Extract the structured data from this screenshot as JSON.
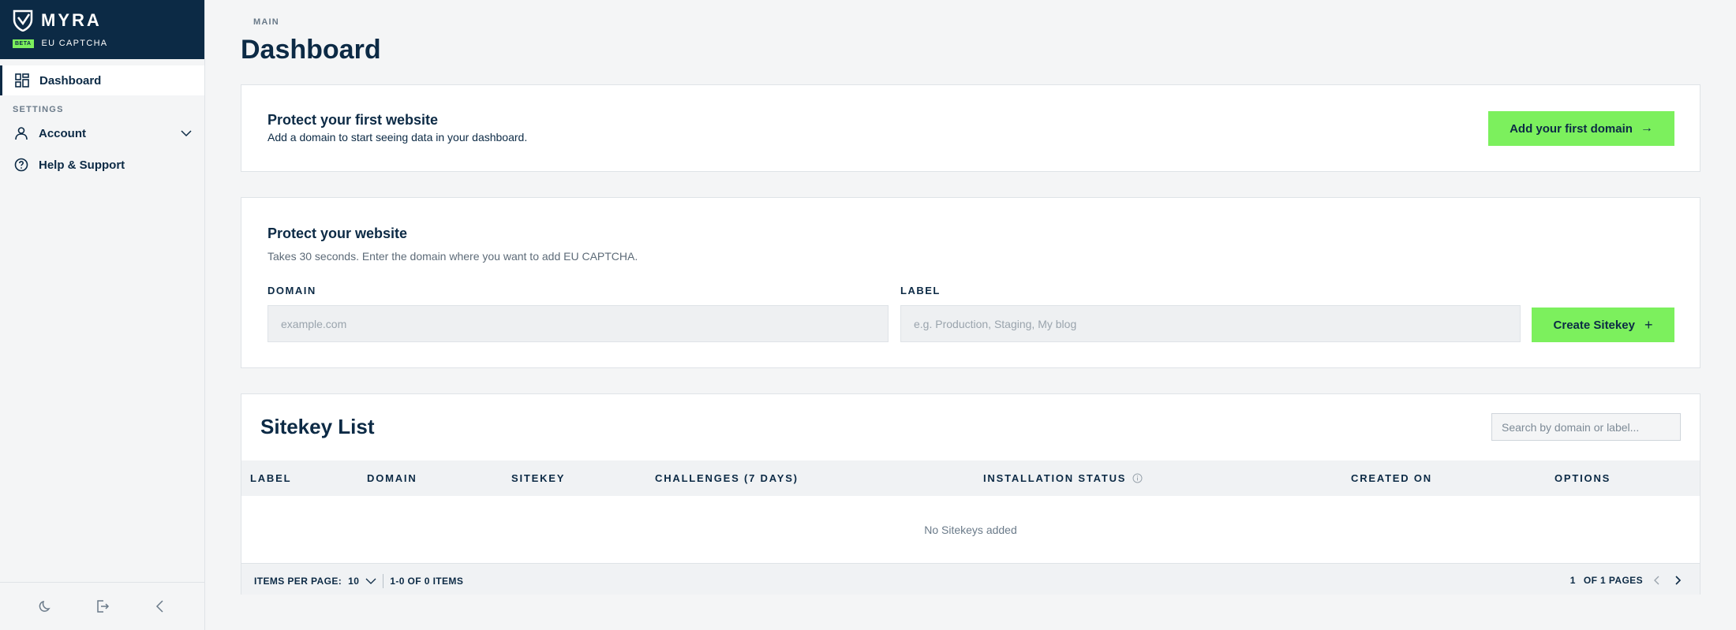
{
  "brand": {
    "name": "MYRA",
    "badge": "BETA",
    "product": "EU CAPTCHA"
  },
  "sidebar": {
    "sections": [
      {
        "label": "MAIN"
      },
      {
        "label": "SETTINGS"
      }
    ],
    "items": [
      {
        "label": "Dashboard",
        "icon": "dashboard-icon",
        "active": true
      },
      {
        "label": "Account",
        "icon": "user-icon"
      },
      {
        "label": "Help & Support",
        "icon": "help-icon"
      }
    ],
    "footer": [
      "moon-icon",
      "logout-icon",
      "collapse-icon"
    ]
  },
  "page": {
    "title": "Dashboard"
  },
  "first_site_card": {
    "title": "Protect your first website",
    "subtitle": "Add a domain to start seeing data in your dashboard.",
    "button": "Add your first domain"
  },
  "protect_card": {
    "title": "Protect your website",
    "subtitle": "Takes 30 seconds. Enter the domain where you want to add EU CAPTCHA.",
    "domain_label": "DOMAIN",
    "domain_placeholder": "example.com",
    "label_label": "LABEL",
    "label_placeholder": "e.g. Production, Staging, My blog",
    "button": "Create Sitekey"
  },
  "sitekey_list": {
    "title": "Sitekey List",
    "search_placeholder": "Search by domain or label...",
    "columns": [
      "LABEL",
      "DOMAIN",
      "SITEKEY",
      "CHALLENGES (7 DAYS)",
      "INSTALLATION STATUS",
      "CREATED ON",
      "OPTIONS"
    ],
    "empty_text": "No Sitekeys added",
    "footer": {
      "per_page_label": "ITEMS PER PAGE:",
      "per_page_value": "10",
      "range_text": "1-0 OF 0 ITEMS",
      "current_page": "1",
      "pages_text": "OF 1 PAGES"
    }
  },
  "colors": {
    "navy": "#0c2a45",
    "accent_green": "#7cf05d",
    "background": "#f4f5f6"
  }
}
